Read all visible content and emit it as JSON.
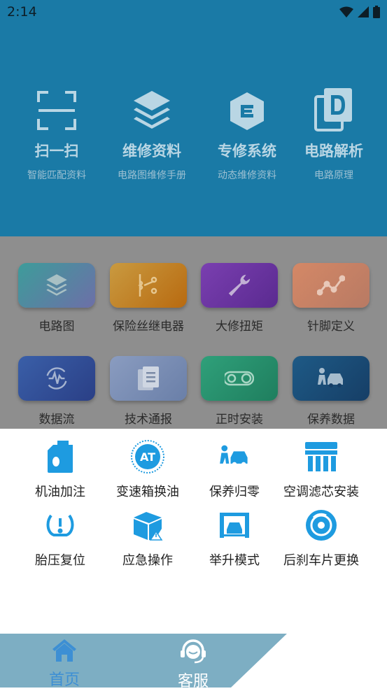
{
  "status_bar": {
    "time": "2:14"
  },
  "hero": [
    {
      "title": "扫一扫",
      "subtitle": "智能匹配资料",
      "icon": "scan-icon"
    },
    {
      "title": "维修资料",
      "subtitle": "电路图维修手册",
      "icon": "layers-icon"
    },
    {
      "title": "专修系统",
      "subtitle": "动态维修资料",
      "icon": "hexagon-e-icon"
    },
    {
      "title": "电路解析",
      "subtitle": "电路原理",
      "icon": "document-d-icon"
    }
  ],
  "grid": [
    {
      "label": "电路图",
      "icon": "layers-icon",
      "color": "#4b9aa8"
    },
    {
      "label": "保险丝继电器",
      "icon": "fuse-icon",
      "color": "#c98a28"
    },
    {
      "label": "大修扭矩",
      "icon": "wrench-icon",
      "color": "#6b3aa0"
    },
    {
      "label": "针脚定义",
      "icon": "pin-graph-icon",
      "color": "#c88660"
    },
    {
      "label": "数据流",
      "icon": "data-wave-icon",
      "color": "#2e4f8c"
    },
    {
      "label": "技术通报",
      "icon": "document-icon",
      "color": "#7a8aa6"
    },
    {
      "label": "正时安装",
      "icon": "timing-belt-icon",
      "color": "#2e8a68"
    },
    {
      "label": "保养数据",
      "icon": "car-service-icon",
      "color": "#1e4e76"
    }
  ],
  "operations": [
    {
      "label": "机油加注",
      "icon": "oil-can-icon"
    },
    {
      "label": "变速箱换油",
      "icon": "at-gearbox-icon",
      "badge": "AT"
    },
    {
      "label": "保养归零",
      "icon": "car-service-icon"
    },
    {
      "label": "空调滤芯安装",
      "icon": "ac-filter-icon"
    },
    {
      "label": "胎压复位",
      "icon": "tire-pressure-icon"
    },
    {
      "label": "应急操作",
      "icon": "emergency-box-icon"
    },
    {
      "label": "举升模式",
      "icon": "lift-icon"
    },
    {
      "label": "后刹车片更换",
      "icon": "brake-disc-icon"
    }
  ],
  "tabs": [
    {
      "label": "首页",
      "icon": "home-icon",
      "active": true
    },
    {
      "label": "客服",
      "icon": "headset-icon",
      "active": false
    }
  ],
  "colors": {
    "accent": "#1a7aa6",
    "icon_blue": "#1e9be0",
    "tab_active": "#3d8fd4"
  }
}
